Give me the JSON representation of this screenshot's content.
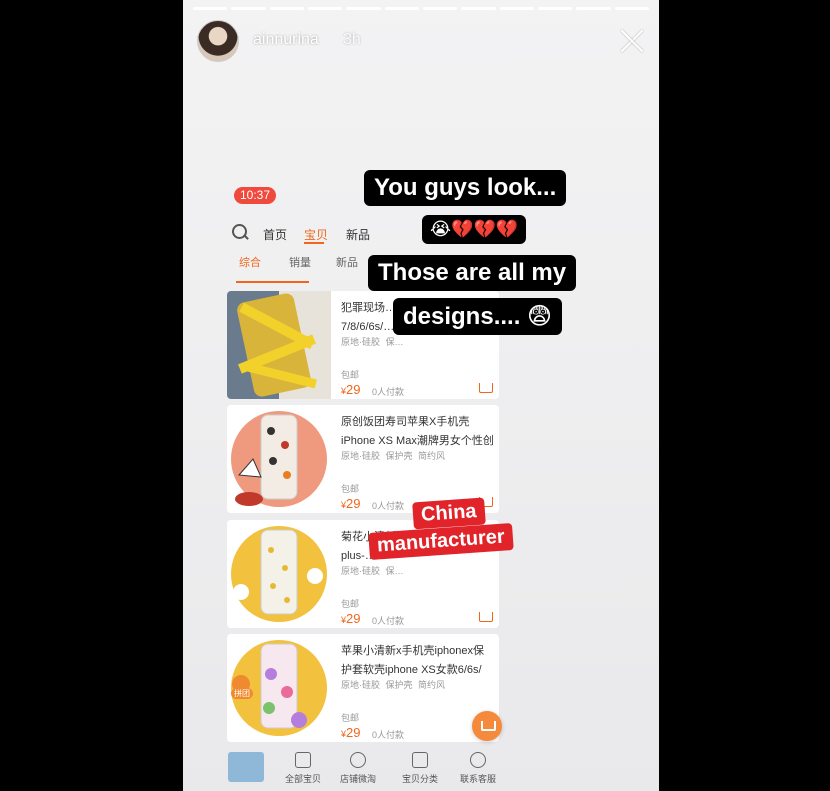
{
  "story": {
    "username": "ainnurina",
    "time_ago": "3h",
    "segments": 12
  },
  "screenshot": {
    "status_time": "10:37",
    "nav": [
      "首页",
      "宝贝",
      "新品"
    ],
    "sort_tabs": [
      "综合",
      "销量",
      "新品"
    ],
    "products": [
      {
        "title": "犯罪现场…苹果…\n7/8/6/6s/…",
        "tags": [
          "原地·硅胶",
          "保…"
        ],
        "shipping": "包邮",
        "price": "29",
        "buyers": "0人付款"
      },
      {
        "title": "原创饭团寿司苹果X手机壳iPhone XS Max潮牌男女个性创意",
        "tags": [
          "原地·硅胶",
          "保护壳",
          "简约风"
        ],
        "shipping": "包邮",
        "price": "29",
        "buyers": "0人付款"
      },
      {
        "title": "菊花小清新iP…\nplus-…",
        "tags": [
          "原地·硅胶",
          "保…"
        ],
        "shipping": "包邮",
        "price": "29",
        "buyers": "0人付款"
      },
      {
        "title": "苹果小清新x手机壳iphonex保护套软壳iphone XS女款6/6s/",
        "tags": [
          "原地·硅胶",
          "保护壳",
          "简约风"
        ],
        "shipping": "包邮",
        "price": "29",
        "buyers": "0人付款"
      }
    ],
    "bottom_tabs": [
      "全部宝贝",
      "店铺微淘",
      "宝贝分类",
      "联系客服"
    ],
    "thumb_badge": "拼团"
  },
  "stickers": {
    "line1": "You guys look...",
    "line2": "😭💔💔💔",
    "line3": "Those are all my",
    "line4": "designs.... 😨",
    "red1": "China",
    "red2": "manufacturer"
  },
  "colors": {
    "accent": "#f0661c",
    "red_sticker": "#e1242a",
    "clock": "#ef4a3c"
  }
}
